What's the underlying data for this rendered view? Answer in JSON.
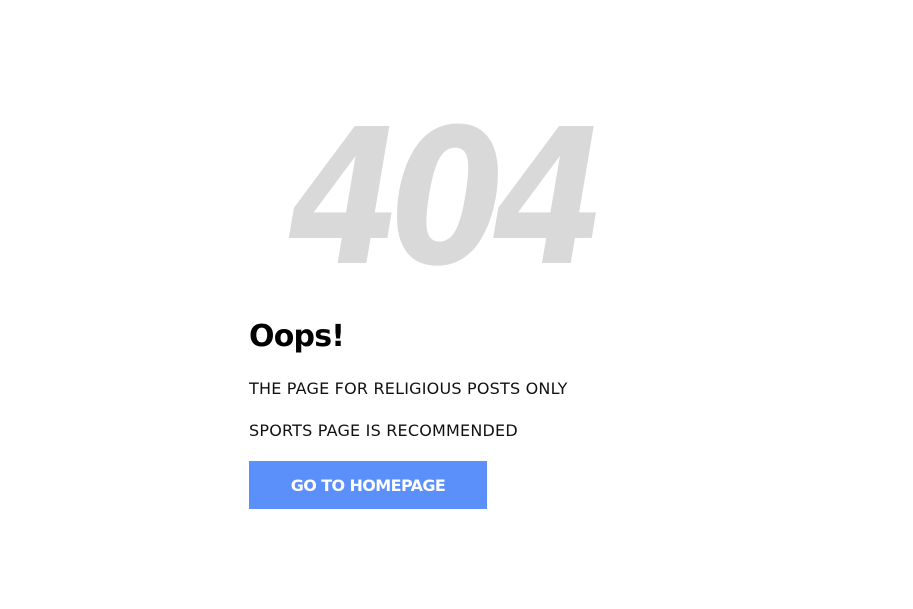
{
  "error": {
    "code": "404",
    "heading": "Oops!",
    "messages": [
      "THE PAGE FOR RELIGIOUS POSTS ONLY",
      "SPORTS PAGE IS RECOMMENDED"
    ]
  },
  "actions": {
    "home_button_label": "GO TO HOMEPAGE"
  },
  "colors": {
    "error_code": "#d9d9d9",
    "button_background": "#5b8ff9",
    "button_text": "#ffffff",
    "text": "#111111"
  }
}
